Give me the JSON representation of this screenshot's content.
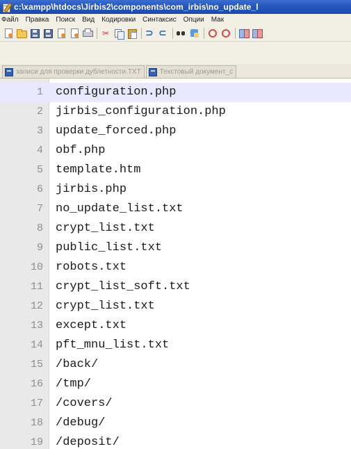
{
  "window": {
    "title": "c:\\xampp\\htdocs\\Jirbis2\\components\\com_irbis\\no_update_l"
  },
  "menu": {
    "items": [
      {
        "label": "Файл"
      },
      {
        "label": "Правка"
      },
      {
        "label": "Поиск"
      },
      {
        "label": "Вид"
      },
      {
        "label": "Кодировки"
      },
      {
        "label": "Синтаксис"
      },
      {
        "label": "Опции"
      },
      {
        "label": "Мак"
      }
    ]
  },
  "toolbar": {
    "buttons": [
      {
        "icon": "new-file-icon"
      },
      {
        "icon": "open-folder-icon"
      },
      {
        "icon": "save-icon"
      },
      {
        "icon": "save-all-icon"
      },
      {
        "icon": "close-icon"
      },
      {
        "icon": "close-all-icon"
      },
      {
        "icon": "print-icon"
      },
      {
        "icon": "cut-icon"
      },
      {
        "icon": "copy-icon"
      },
      {
        "icon": "paste-icon"
      },
      {
        "icon": "undo-icon"
      },
      {
        "icon": "redo-icon"
      },
      {
        "icon": "find-icon"
      },
      {
        "icon": "replace-icon"
      },
      {
        "icon": "zoom-in-icon"
      },
      {
        "icon": "zoom-out-icon"
      },
      {
        "icon": "sync-vertical-icon"
      },
      {
        "icon": "sync-horizontal-icon"
      }
    ]
  },
  "tabs": [
    {
      "label": "записи для проверки дублетности.TXT",
      "active": false
    },
    {
      "label": "Текстовый документ_с",
      "active": false
    }
  ],
  "editor": {
    "current_line": 1,
    "lines": [
      {
        "num": "1",
        "text": "configuration.php"
      },
      {
        "num": "2",
        "text": "jirbis_configuration.php"
      },
      {
        "num": "3",
        "text": "update_forced.php"
      },
      {
        "num": "4",
        "text": "obf.php"
      },
      {
        "num": "5",
        "text": "template.htm"
      },
      {
        "num": "6",
        "text": "jirbis.php"
      },
      {
        "num": "7",
        "text": "no_update_list.txt"
      },
      {
        "num": "8",
        "text": "crypt_list.txt"
      },
      {
        "num": "9",
        "text": "public_list.txt"
      },
      {
        "num": "10",
        "text": "robots.txt"
      },
      {
        "num": "11",
        "text": "crypt_list_soft.txt"
      },
      {
        "num": "12",
        "text": "crypt_list.txt"
      },
      {
        "num": "13",
        "text": "except.txt"
      },
      {
        "num": "14",
        "text": "pft_mnu_list.txt"
      },
      {
        "num": "15",
        "text": "/back/"
      },
      {
        "num": "16",
        "text": "/tmp/"
      },
      {
        "num": "17",
        "text": "/covers/"
      },
      {
        "num": "18",
        "text": "/debug/"
      },
      {
        "num": "19",
        "text": "/deposit/"
      }
    ]
  },
  "colors": {
    "titlebar": "#2457be",
    "current_line_highlight": "#e8e8ff",
    "gutter": "#e9e9e9",
    "line_number": "#8e8e8e"
  }
}
